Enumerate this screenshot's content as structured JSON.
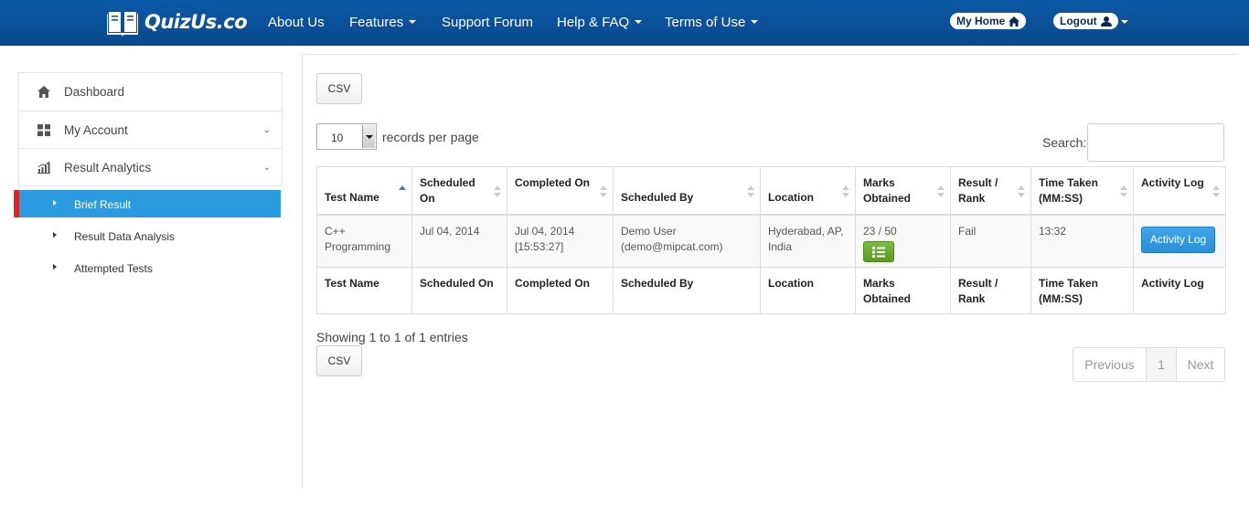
{
  "brand": {
    "name": "QuizUs.co"
  },
  "nav": {
    "items": [
      {
        "label": "About Us",
        "has_caret": false
      },
      {
        "label": "Features",
        "has_caret": true
      },
      {
        "label": "Support Forum",
        "has_caret": false
      },
      {
        "label": "Help & FAQ",
        "has_caret": true
      },
      {
        "label": "Terms of Use",
        "has_caret": true
      }
    ],
    "my_home": "My Home",
    "logout": "Logout"
  },
  "sidebar": {
    "items": [
      {
        "label": "Dashboard",
        "icon": "home-icon"
      },
      {
        "label": "My Account",
        "icon": "grid-icon"
      },
      {
        "label": "Result Analytics",
        "icon": "bar-chart-icon"
      }
    ],
    "sub_items": [
      {
        "label": "Brief Result",
        "active": true
      },
      {
        "label": "Result Data Analysis",
        "active": false
      },
      {
        "label": "Attempted Tests",
        "active": false
      }
    ]
  },
  "toolbar": {
    "csv_label": "CSV",
    "records_per_page_value": "10",
    "records_per_page_label": "records per page",
    "search_label": "Search:"
  },
  "table": {
    "headers": [
      "Test Name",
      "Scheduled On",
      "Completed On",
      "Scheduled By",
      "Location",
      "Marks Obtained",
      "Result / Rank",
      "Time Taken (MM:SS)",
      "Activity Log"
    ],
    "rows": [
      {
        "test_name": "C++ Programming",
        "scheduled_on": "Jul 04, 2014",
        "completed_on": "Jul 04, 2014 [15:53:27]",
        "scheduled_by": "Demo User (demo@mipcat.com)",
        "location": "Hyderabad, AP, India",
        "marks": "23 / 50",
        "result": "Fail",
        "time_taken": "13:32",
        "activity_log_button": "Activity Log"
      }
    ],
    "footers": [
      "Test Name",
      "Scheduled On",
      "Completed On",
      "Scheduled By",
      "Location",
      "Marks Obtained",
      "Result / Rank",
      "Time Taken (MM:SS)",
      "Activity Log"
    ]
  },
  "showing_text": "Showing 1 to 1 of 1 entries",
  "pager": {
    "previous": "Previous",
    "page": "1",
    "next": "Next"
  },
  "colors": {
    "nav_bg": "#0c58a6",
    "active_item": "#2b9be0",
    "active_marker": "#e02424",
    "activity_btn": "#2a8fd6",
    "marks_btn": "#5a9a22"
  }
}
